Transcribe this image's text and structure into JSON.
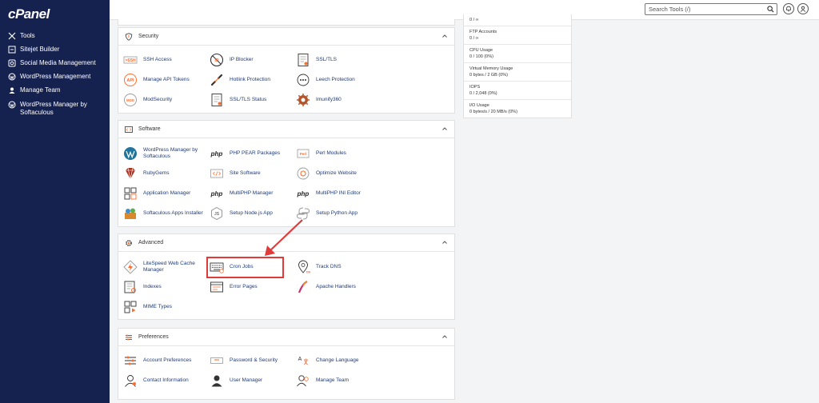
{
  "sidebar": {
    "logo": "cPanel",
    "items": [
      {
        "label": "Tools",
        "icon": "tools-icon"
      },
      {
        "label": "Sitejet Builder",
        "icon": "sitejet-icon"
      },
      {
        "label": "Social Media Management",
        "icon": "social-media-icon"
      },
      {
        "label": "WordPress Management",
        "icon": "wordpress-icon"
      },
      {
        "label": "Manage Team",
        "icon": "team-icon"
      },
      {
        "label": "WordPress Manager by Softaculous",
        "icon": "wordpress-icon"
      }
    ]
  },
  "topbar": {
    "search_placeholder": "Search Tools (/)"
  },
  "sections": {
    "security": {
      "title": "Security",
      "items": [
        "SSH Access",
        "IP Blocker",
        "SSL/TLS",
        "Manage API Tokens",
        "Hotlink Protection",
        "Leech Protection",
        "ModSecurity",
        "SSL/TLS Status",
        "Imunify360"
      ]
    },
    "software": {
      "title": "Software",
      "items": [
        "WordPress Manager by Softaculous",
        "PHP PEAR Packages",
        "Perl Modules",
        "RubyGems",
        "Site Software",
        "Optimize Website",
        "Application Manager",
        "MultiPHP Manager",
        "MultiPHP INI Editor",
        "Softaculous Apps Installer",
        "Setup Node.js App",
        "Setup Python App"
      ]
    },
    "advanced": {
      "title": "Advanced",
      "items": [
        "LiteSpeed Web Cache Manager",
        "Cron Jobs",
        "Track DNS",
        "Indexes",
        "Error Pages",
        "Apache Handlers",
        "MIME Types"
      ]
    },
    "preferences": {
      "title": "Preferences",
      "items": [
        "Account Preferences",
        "Password & Security",
        "Change Language",
        "Contact Information",
        "User Manager",
        "Manage Team"
      ]
    }
  },
  "stats": [
    {
      "label": "",
      "value": "0 / ∞"
    },
    {
      "label": "FTP Accounts",
      "value": "0 / ∞"
    },
    {
      "label": "CPU Usage",
      "value": "0 / 100   (0%)"
    },
    {
      "label": "Virtual Memory Usage",
      "value": "0 bytes / 2 GB   (0%)"
    },
    {
      "label": "IOPS",
      "value": "0 / 2,048   (0%)"
    },
    {
      "label": "I/O Usage",
      "value": "0 bytes/s / 20 MB/s   (0%)"
    }
  ],
  "colors": {
    "sidebar_bg": "#15214f",
    "link": "#1f3b7a",
    "accent": "#ff6c2c",
    "highlight": "#e03a3a"
  }
}
